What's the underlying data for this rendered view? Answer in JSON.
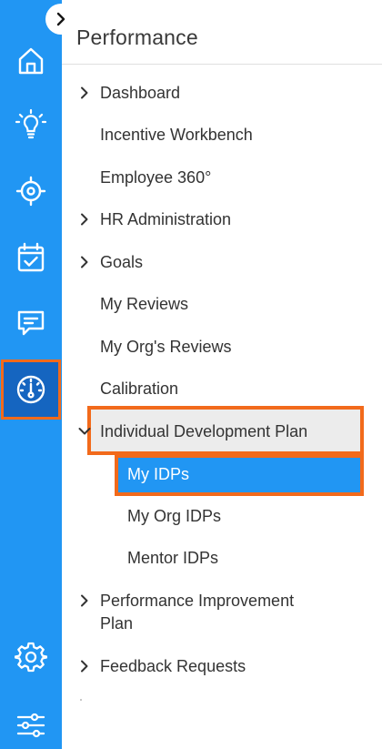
{
  "panel": {
    "title": "Performance"
  },
  "rail": {
    "icons": [
      "home-icon",
      "lightbulb-icon",
      "target-icon",
      "calendar-check-icon",
      "chat-icon",
      "gauge-icon",
      "gear-icon",
      "sliders-icon"
    ],
    "active": "gauge-icon",
    "color": "#2196f3",
    "active_color": "#1565c0"
  },
  "highlight_color": "#f26a1b",
  "menu": {
    "dashboard": "Dashboard",
    "incentive_workbench": "Incentive Workbench",
    "employee_360": "Employee 360°",
    "hr_administration": "HR Administration",
    "goals": "Goals",
    "my_reviews": "My Reviews",
    "my_org_reviews": "My Org's Reviews",
    "calibration": "Calibration",
    "idp": "Individual Development Plan",
    "my_idps": "My IDPs",
    "my_org_idps": "My Org IDPs",
    "mentor_idps": "Mentor IDPs",
    "pip_line1": "Performance Improvement",
    "pip_line2": "Plan",
    "feedback_requests": "Feedback Requests"
  }
}
